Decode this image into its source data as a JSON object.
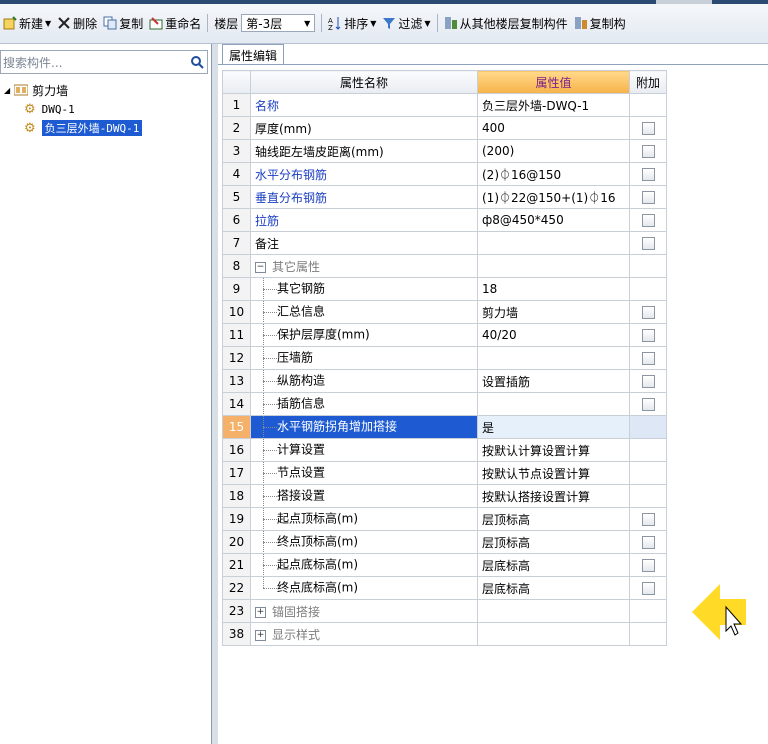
{
  "toolbar": {
    "new_label": "新建",
    "delete_label": "删除",
    "copy_label": "复制",
    "rename_label": "重命名",
    "floor_label": "楼层",
    "floor_value": "第-3层",
    "sort_label": "排序",
    "filter_label": "过滤",
    "copy_from_floor_label": "从其他楼层复制构件",
    "copy_to_label": "复制构"
  },
  "left_panel": {
    "search_placeholder": "搜索构件...",
    "tree_root": "剪力墙",
    "tree_items": [
      "DWQ-1",
      "负三层外墙-DWQ-1"
    ]
  },
  "tab_label": "属性编辑",
  "table": {
    "headers": [
      "属性名称",
      "属性值",
      "附加"
    ],
    "rows": [
      {
        "num": "1",
        "name": "名称",
        "value": "负三层外墙-DWQ-1",
        "blue": true,
        "check": false
      },
      {
        "num": "2",
        "name": "厚度(mm)",
        "value": "400",
        "blue": false,
        "check": true
      },
      {
        "num": "3",
        "name": "轴线距左墙皮距离(mm)",
        "value": "(200)",
        "blue": false,
        "check": true
      },
      {
        "num": "4",
        "name": "水平分布钢筋",
        "value": "(2)⏀16@150",
        "blue": true,
        "check": true
      },
      {
        "num": "5",
        "name": "垂直分布钢筋",
        "value": "(1)⏀22@150+(1)⏀16",
        "blue": true,
        "check": true
      },
      {
        "num": "6",
        "name": "拉筋",
        "value": "ф8@450*450",
        "blue": true,
        "check": true
      },
      {
        "num": "7",
        "name": "备注",
        "value": "",
        "blue": false,
        "check": true
      },
      {
        "num": "8",
        "name": "其它属性",
        "value": "",
        "group": "collapse",
        "check": false
      },
      {
        "num": "9",
        "name": "其它钢筋",
        "value": "18",
        "child": true,
        "check": false
      },
      {
        "num": "10",
        "name": "汇总信息",
        "value": "剪力墙",
        "child": true,
        "check": true
      },
      {
        "num": "11",
        "name": "保护层厚度(mm)",
        "value": "40/20",
        "child": true,
        "check": true
      },
      {
        "num": "12",
        "name": "压墙筋",
        "value": "",
        "child": true,
        "check": true
      },
      {
        "num": "13",
        "name": "纵筋构造",
        "value": "设置插筋",
        "child": true,
        "check": true
      },
      {
        "num": "14",
        "name": "插筋信息",
        "value": "",
        "child": true,
        "check": true
      },
      {
        "num": "15",
        "name": "水平钢筋拐角增加搭接",
        "value": "是",
        "child": true,
        "check": false,
        "active": true
      },
      {
        "num": "16",
        "name": "计算设置",
        "value": "按默认计算设置计算",
        "child": true,
        "check": false
      },
      {
        "num": "17",
        "name": "节点设置",
        "value": "按默认节点设置计算",
        "child": true,
        "check": false
      },
      {
        "num": "18",
        "name": "搭接设置",
        "value": "按默认搭接设置计算",
        "child": true,
        "check": false
      },
      {
        "num": "19",
        "name": "起点顶标高(m)",
        "value": "层顶标高",
        "child": true,
        "check": true
      },
      {
        "num": "20",
        "name": "终点顶标高(m)",
        "value": "层顶标高",
        "child": true,
        "check": true
      },
      {
        "num": "21",
        "name": "起点底标高(m)",
        "value": "层底标高",
        "child": true,
        "check": true
      },
      {
        "num": "22",
        "name": "终点底标高(m)",
        "value": "层底标高",
        "child": true,
        "check": true,
        "last": true
      },
      {
        "num": "23",
        "name": "锚固搭接",
        "value": "",
        "group": "expand",
        "check": false
      },
      {
        "num": "38",
        "name": "显示样式",
        "value": "",
        "group": "expand",
        "check": false
      }
    ]
  }
}
